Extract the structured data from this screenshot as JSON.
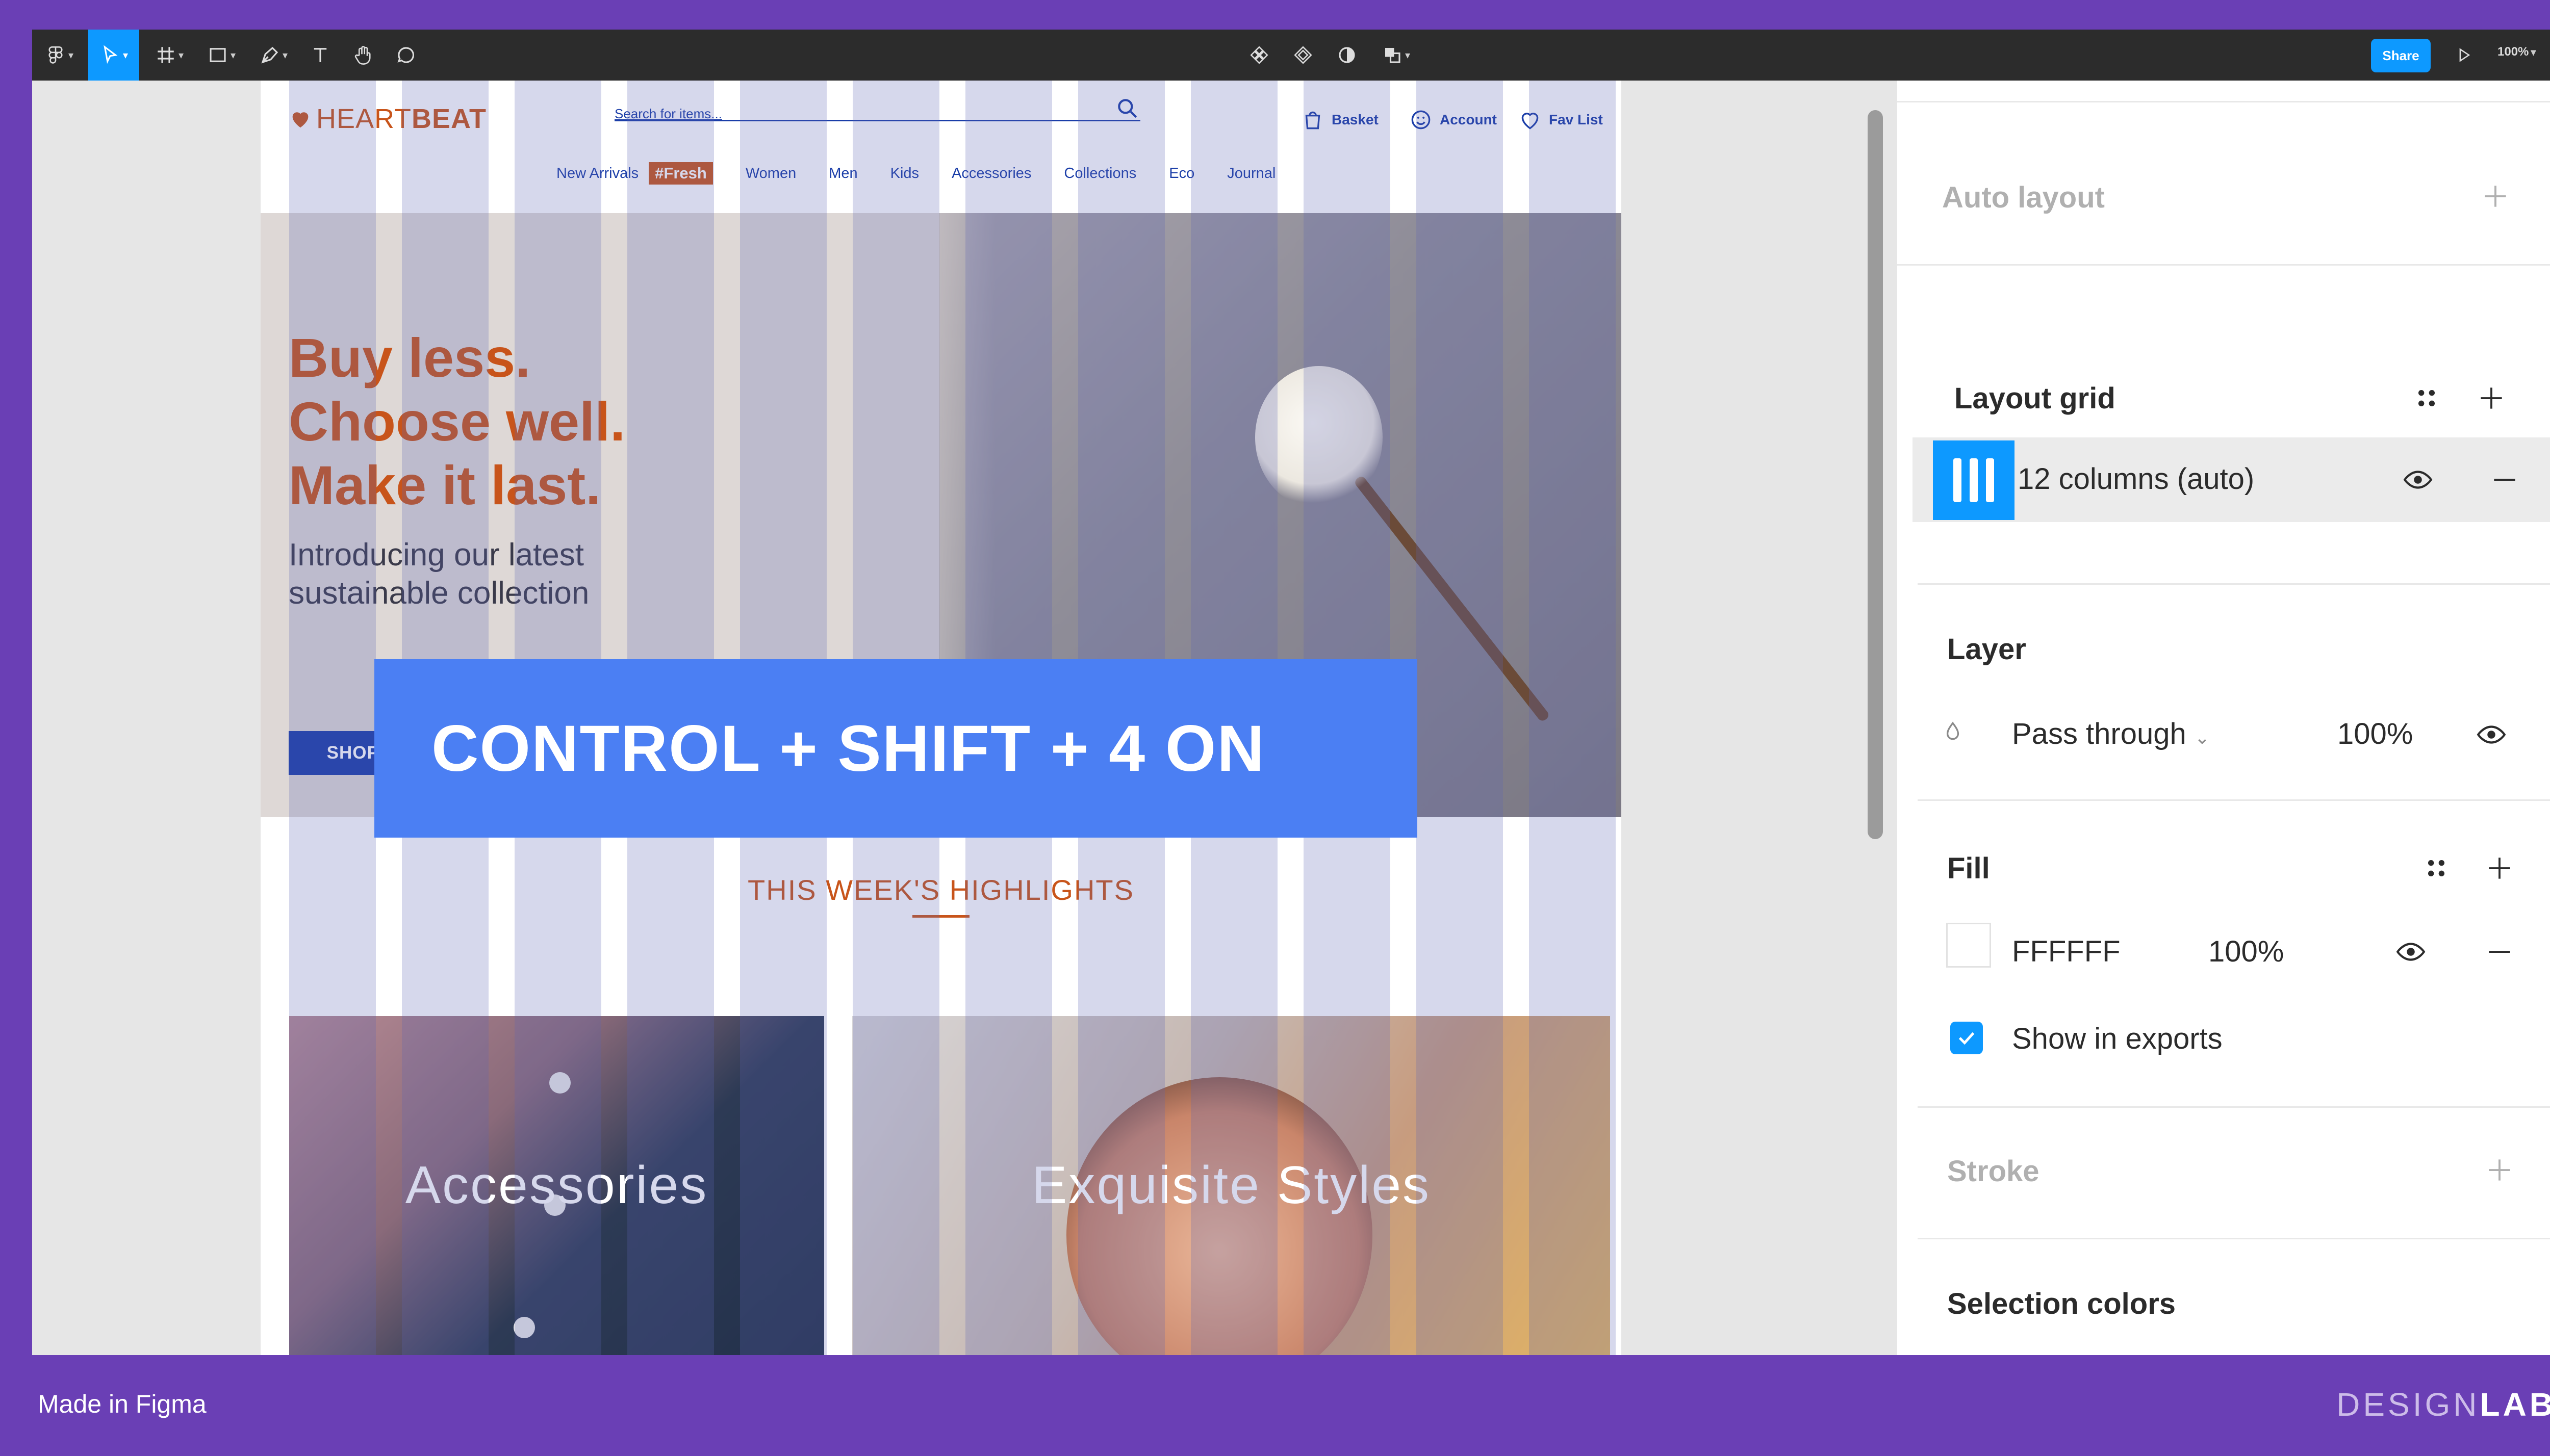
{
  "toolbar": {
    "tools": [
      "main-menu",
      "move",
      "frame",
      "shape",
      "pen",
      "text",
      "hand",
      "comment"
    ],
    "share_label": "Share",
    "zoom_label": "100%"
  },
  "site": {
    "logo_light": "HEART",
    "logo_bold": "BEAT",
    "search_placeholder": "Search for items...",
    "basket": "Basket",
    "account": "Account",
    "favlist": "Fav List",
    "nav": [
      "New Arrivals",
      "#Fresh",
      "Women",
      "Men",
      "Kids",
      "Accessories",
      "Collections",
      "Eco",
      "Journal"
    ],
    "headline": [
      "Buy less.",
      "Choose well.",
      "Make it last."
    ],
    "subtitle": [
      "Introducing our latest",
      "sustainable collection"
    ],
    "cta": "SHOP COLLECTION",
    "highlights": "THIS WEEK'S HIGHLIGHTS",
    "cards": [
      "Accessories",
      "Exquisite Styles"
    ]
  },
  "overlay": {
    "shortcut": "CONTROL + SHIFT + 4 ON"
  },
  "panel": {
    "auto_layout": "Auto layout",
    "layout_grid": "Layout grid",
    "grid_label": "12 columns (auto)",
    "layer": "Layer",
    "blend_mode": "Pass through",
    "layer_opacity": "100%",
    "fill": "Fill",
    "fill_hex": "FFFFFF",
    "fill_opacity": "100%",
    "show_in_exports": "Show in exports",
    "show_in_exports_checked": true,
    "stroke": "Stroke",
    "selection_colors": "Selection colors"
  },
  "footer": {
    "made_in": "Made in Figma",
    "brand_light": "DESIGN",
    "brand_bold": "LAB"
  },
  "colors": {
    "brand_orange": "#c8541a",
    "brand_blue": "#1a3da8",
    "figma_blue": "#0d99ff",
    "overlay_blue": "#4b7ff3",
    "background_purple": "#6a3fb5"
  }
}
